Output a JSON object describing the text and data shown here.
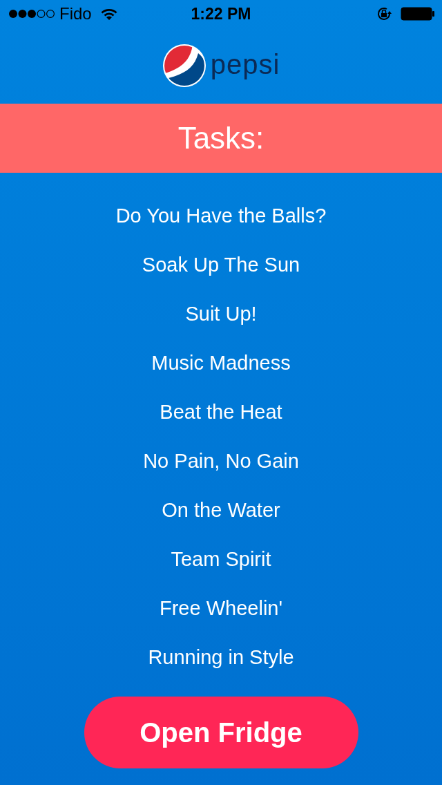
{
  "status_bar": {
    "carrier": "Fido",
    "time": "1:22 PM"
  },
  "logo": {
    "wordmark": "pepsi"
  },
  "banner": {
    "title": "Tasks:"
  },
  "tasks": [
    {
      "label": "Do You Have the Balls?"
    },
    {
      "label": "Soak Up The Sun"
    },
    {
      "label": "Suit Up!"
    },
    {
      "label": "Music Madness"
    },
    {
      "label": "Beat the Heat"
    },
    {
      "label": "No Pain, No Gain"
    },
    {
      "label": "On the Water"
    },
    {
      "label": "Team Spirit"
    },
    {
      "label": "Free Wheelin'"
    },
    {
      "label": "Running in Style"
    }
  ],
  "primary_button": {
    "label": "Open Fridge"
  }
}
